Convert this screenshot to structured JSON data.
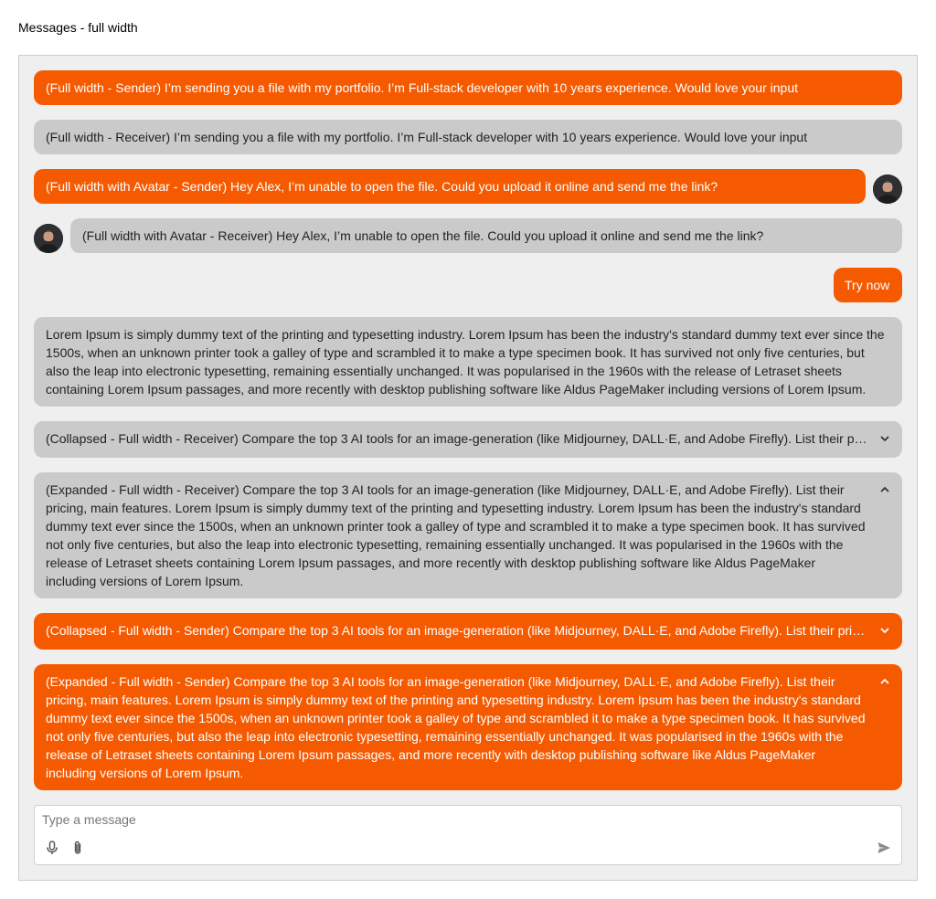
{
  "page": {
    "title": "Messages - full width"
  },
  "colors": {
    "sender_bg": "#f55a00",
    "receiver_bg": "#cacaca",
    "panel_bg": "#efefef"
  },
  "messages": [
    {
      "text": "(Full width - Sender) I’m sending you a file with my portfolio. I’m Full-stack developer with 10 years experience. Would love your input"
    },
    {
      "text": "(Full width - Receiver) I’m sending you a file with my portfolio. I’m Full-stack developer with 10 years experience. Would love your input"
    },
    {
      "text": "(Full width with Avatar - Sender) Hey Alex, I’m unable to open the file. Could you upload it online and send me the link?"
    },
    {
      "text": "(Full width with Avatar - Receiver) Hey Alex, I’m unable to open the file. Could you upload it online and send me the link?"
    },
    {
      "text": "Try now"
    },
    {
      "text": "Lorem Ipsum is simply dummy text of the printing and typesetting industry. Lorem Ipsum has been the industry's standard dummy text ever since the 1500s, when an unknown printer took a galley of type and scrambled it to make a type specimen book. It has survived not only five centuries, but also the leap into electronic typesetting, remaining essentially unchanged. It was popularised in the 1960s with the release of Letraset sheets containing Lorem Ipsum passages, and more recently with desktop publishing software like Aldus PageMaker including versions of Lorem Ipsum."
    },
    {
      "text": "(Collapsed - Full width - Receiver) Compare the top 3 AI tools for an image-generation (like Midjourney, DALL·E, and Adobe Firefly). List their pricing, main features."
    },
    {
      "text": "(Expanded - Full width - Receiver) Compare the top 3 AI tools for an image-generation (like Midjourney, DALL·E, and Adobe Firefly). List their pricing, main features. Lorem Ipsum is simply dummy text of the printing and typesetting industry. Lorem Ipsum has been the industry's standard dummy text ever since the 1500s, when an unknown printer took a galley of type and scrambled it to make a type specimen book. It has survived not only five centuries, but also the leap into electronic typesetting, remaining essentially unchanged. It was popularised in the 1960s with the release of Letraset sheets containing Lorem Ipsum passages, and more recently with desktop publishing software like Aldus PageMaker including versions of Lorem Ipsum."
    },
    {
      "text": "(Collapsed - Full width - Sender) Compare the top 3 AI tools for an image-generation (like Midjourney, DALL·E, and Adobe Firefly). List their pricing, main features."
    },
    {
      "text": "(Expanded - Full width - Sender) Compare the top 3 AI tools for an image-generation (like Midjourney, DALL·E, and Adobe Firefly). List their pricing, main features. Lorem Ipsum is simply dummy text of the printing and typesetting industry. Lorem Ipsum has been the industry's standard dummy text ever since the 1500s, when an unknown printer took a galley of type and scrambled it to make a type specimen book. It has survived not only five centuries, but also the leap into electronic typesetting, remaining essentially unchanged. It was popularised in the 1960s with the release of Letraset sheets containing Lorem Ipsum passages, and more recently with desktop publishing software like Aldus PageMaker including versions of Lorem Ipsum."
    }
  ],
  "composer": {
    "placeholder": "Type a message",
    "icons": [
      "microphone-icon",
      "paperclip-icon",
      "send-icon"
    ]
  }
}
